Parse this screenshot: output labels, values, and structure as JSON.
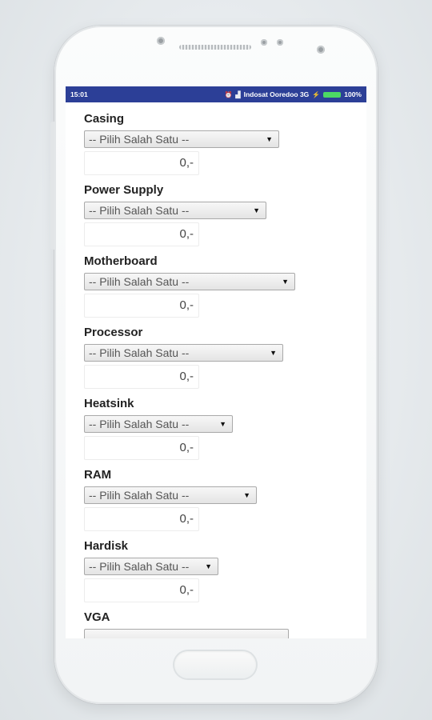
{
  "status_bar": {
    "time": "15:01",
    "carrier": "Indosat Ooredoo 3G",
    "battery": "100%"
  },
  "form": {
    "placeholder": "-- Pilih Salah Satu --",
    "fields": [
      {
        "label": "Casing",
        "select": "-- Pilih Salah Satu --",
        "price": "0,-"
      },
      {
        "label": "Power Supply",
        "select": "-- Pilih Salah Satu --",
        "price": "0,-"
      },
      {
        "label": "Motherboard",
        "select": "-- Pilih Salah Satu --",
        "price": "0,-"
      },
      {
        "label": "Processor",
        "select": "-- Pilih Salah Satu --",
        "price": "0,-"
      },
      {
        "label": "Heatsink",
        "select": "-- Pilih Salah Satu --",
        "price": "0,-"
      },
      {
        "label": "RAM",
        "select": "-- Pilih Salah Satu --",
        "price": "0,-"
      },
      {
        "label": "Hardisk",
        "select": "-- Pilih Salah Satu --",
        "price": "0,-"
      },
      {
        "label": "VGA"
      }
    ]
  },
  "colors": {
    "status_bar": "#2c3f97",
    "battery": "#4cd964"
  }
}
